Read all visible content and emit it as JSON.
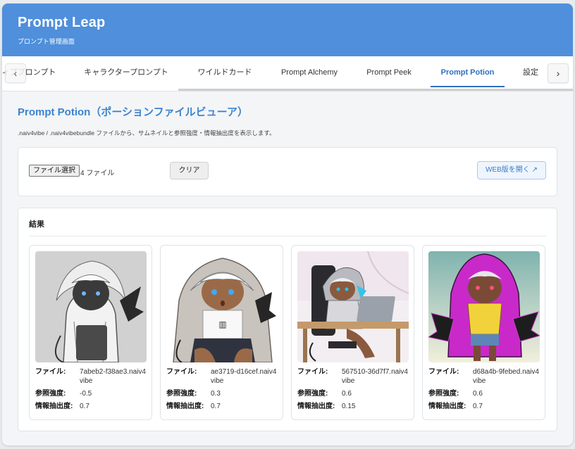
{
  "header": {
    "title": "Prompt Leap",
    "subtitle": "プロンプト管理画面"
  },
  "tabs": [
    {
      "label": "ィププロンプト",
      "active": false
    },
    {
      "label": "キャラクタープロンプト",
      "active": false
    },
    {
      "label": "ワイルドカード",
      "active": false
    },
    {
      "label": "Prompt Alchemy",
      "active": false
    },
    {
      "label": "Prompt Peek",
      "active": false
    },
    {
      "label": "Prompt Potion",
      "active": true
    },
    {
      "label": "設定",
      "active": false
    }
  ],
  "nav": {
    "scroll_left": "‹",
    "scroll_right": "›"
  },
  "page": {
    "title": "Prompt Potion（ポーションファイルビューア）",
    "description": ".naiv4vibe / .naiv4vibebundle ファイルから、サムネイルと参照強度・情報抽出度を表示します。"
  },
  "controls": {
    "file_button": "ファイル選択",
    "file_count": "4 ファイル",
    "clear_button": "クリア",
    "web_button": "WEB版を開く ↗"
  },
  "results": {
    "title": "結果",
    "labels": {
      "file": "ファイル:",
      "strength": "参照強度:",
      "info": "情報抽出度:"
    },
    "cards": [
      {
        "file": "7abeb2-f38ae3.naiv4vibe",
        "strength": "-0.5",
        "info": "0.7"
      },
      {
        "file": "ae3719-d16cef.naiv4vibe",
        "strength": "0.3",
        "info": "0.7"
      },
      {
        "file": "567510-36d7f7.naiv4vibe",
        "strength": "0.6",
        "info": "0.15"
      },
      {
        "file": "d68a4b-9febed.naiv4vibe",
        "strength": "0.6",
        "info": "0.7"
      }
    ]
  },
  "colors": {
    "header_bg": "#4f8fdb",
    "accent": "#2f6fbf",
    "page_title": "#3b84d0"
  }
}
